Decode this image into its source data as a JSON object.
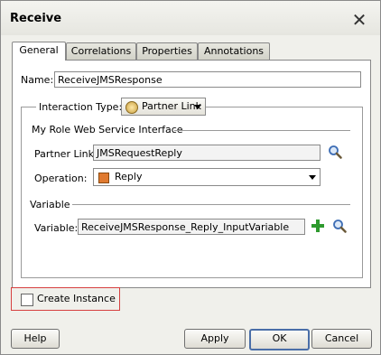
{
  "window": {
    "title": "Receive"
  },
  "tabs": [
    {
      "label": "General",
      "active": true
    },
    {
      "label": "Correlations",
      "active": false
    },
    {
      "label": "Properties",
      "active": false
    },
    {
      "label": "Annotations",
      "active": false
    }
  ],
  "general": {
    "name_label": "Name:",
    "name_value": "ReceiveJMSResponse",
    "interaction_type_label": "Interaction Type:",
    "interaction_type_value": "Partner Link",
    "my_role_section": "My Role Web Service Interface",
    "partner_link_label": "Partner Link:",
    "partner_link_value": "JMSRequestReply",
    "operation_label": "Operation:",
    "operation_value": "Reply",
    "variable_section": "Variable",
    "variable_label": "Variable:",
    "variable_value": "ReceiveJMSResponse_Reply_InputVariable",
    "create_instance_label": "Create Instance",
    "create_instance_checked": false
  },
  "buttons": {
    "help": "Help",
    "apply": "Apply",
    "ok": "OK",
    "cancel": "Cancel"
  },
  "colors": {
    "highlight": "#d64040",
    "add_icon": "#2e9a2e",
    "search_icon": "#3d6db5"
  }
}
